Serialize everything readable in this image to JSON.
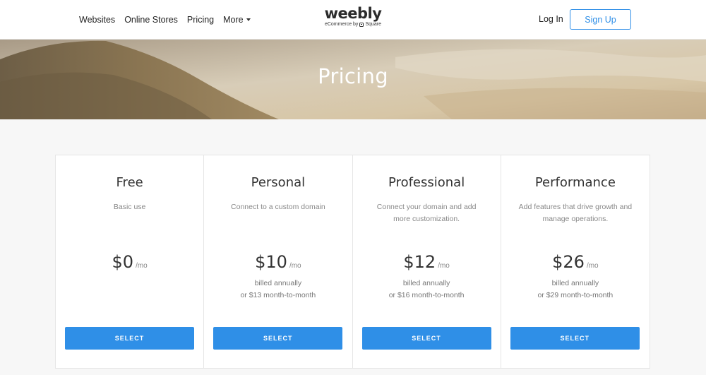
{
  "nav": {
    "items": [
      {
        "label": "Websites"
      },
      {
        "label": "Online Stores"
      },
      {
        "label": "Pricing"
      }
    ],
    "more_label": "More",
    "login_label": "Log In",
    "signup_label": "Sign Up"
  },
  "logo": {
    "word": "weebly",
    "sub_prefix": "eCommerce by",
    "sub_brand": "Square"
  },
  "hero": {
    "title": "Pricing"
  },
  "plans": [
    {
      "name": "Free",
      "description": "Basic use",
      "price": "$0",
      "period": "/mo",
      "billing_line1": "",
      "billing_line2": "",
      "button": "SELECT"
    },
    {
      "name": "Personal",
      "description": "Connect to a custom domain",
      "price": "$10",
      "period": "/mo",
      "billing_line1": "billed annually",
      "billing_line2": "or $13 month-to-month",
      "button": "SELECT"
    },
    {
      "name": "Professional",
      "description": "Connect your domain and add more customization.",
      "price": "$12",
      "period": "/mo",
      "billing_line1": "billed annually",
      "billing_line2": "or $16 month-to-month",
      "button": "SELECT"
    },
    {
      "name": "Performance",
      "description": "Add features that drive growth and manage operations.",
      "price": "$26",
      "period": "/mo",
      "billing_line1": "billed annually",
      "billing_line2": "or $29 month-to-month",
      "button": "SELECT"
    }
  ],
  "colors": {
    "accent": "#2f8fe7",
    "page_bg": "#f7f7f7"
  }
}
